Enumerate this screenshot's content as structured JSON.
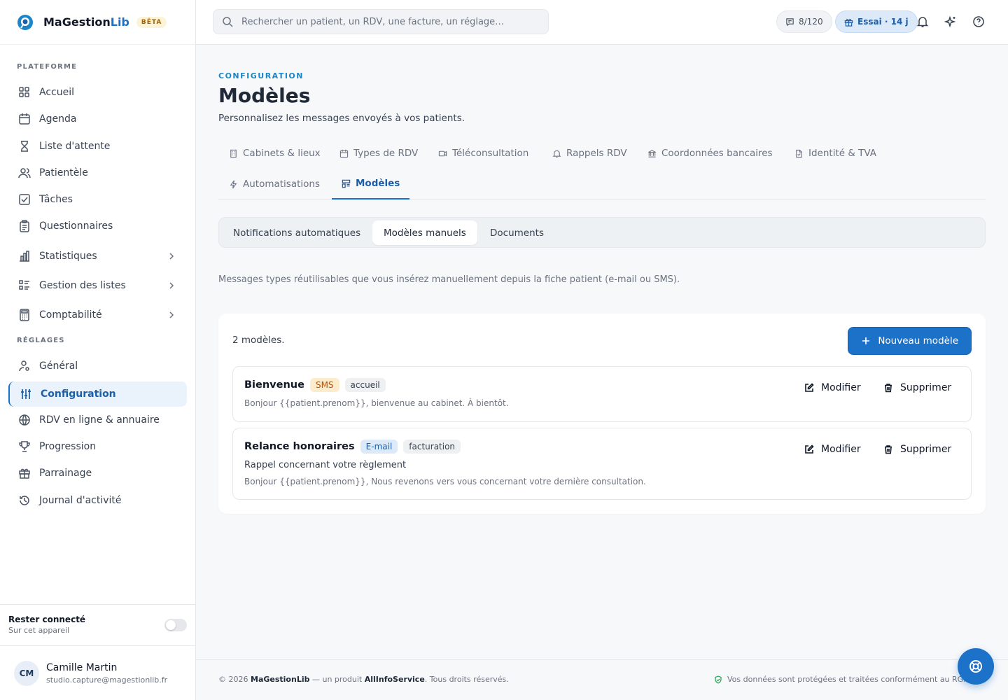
{
  "app": {
    "name_main": "MaGestion",
    "name_accent": "Lib",
    "beta": "BÊTA"
  },
  "sidebar": {
    "section_platform": "PLATEFORME",
    "section_settings": "RÉGLAGES",
    "items": [
      {
        "label": "Accueil",
        "icon": "dashboard-icon"
      },
      {
        "label": "Agenda",
        "icon": "calendar-icon"
      },
      {
        "label": "Liste d'attente",
        "icon": "hourglass-icon"
      },
      {
        "label": "Patientèle",
        "icon": "users-icon"
      },
      {
        "label": "Tâches",
        "icon": "checkbox-icon"
      },
      {
        "label": "Questionnaires",
        "icon": "clipboard-icon"
      },
      {
        "label": "Statistiques",
        "icon": "bar-chart-icon"
      },
      {
        "label": "Gestion des listes",
        "icon": "list-icon"
      },
      {
        "label": "Comptabilité",
        "icon": "calculator-icon"
      },
      {
        "label": "Général",
        "icon": "user-settings-icon"
      },
      {
        "label": "Configuration",
        "icon": "sliders-icon"
      },
      {
        "label": "RDV en ligne & annuaire",
        "icon": "globe-icon"
      },
      {
        "label": "Progression",
        "icon": "trophy-icon"
      },
      {
        "label": "Parrainage",
        "icon": "gift-icon"
      },
      {
        "label": "Journal d'activité",
        "icon": "history-icon"
      }
    ],
    "stay": {
      "title": "Rester connecté",
      "subtitle": "Sur cet appareil"
    },
    "user": {
      "initials": "CM",
      "name": "Camille Martin",
      "email": "studio.capture@magestionlib.fr"
    }
  },
  "topbar": {
    "search_placeholder": "Rechercher un patient, un RDV, une facture, un réglage…",
    "quota": "8/120",
    "trial": "Essai · 14 j"
  },
  "page": {
    "eyebrow": "CONFIGURATION",
    "title": "Modèles",
    "subtitle": "Personnalisez les messages envoyés à vos patients.",
    "tabs": [
      "Cabinets & lieux",
      "Types de RDV",
      "Téléconsultation",
      "Rappels RDV",
      "Coordonnées bancaires",
      "Identité & TVA",
      "Automatisations",
      "Modèles"
    ],
    "segments": [
      "Notifications automatiques",
      "Modèles manuels",
      "Documents"
    ],
    "description": "Messages types réutilisables que vous insérez manuellement depuis la fiche patient (e-mail ou SMS).",
    "count": "2 modèles.",
    "new_button": "Nouveau modèle",
    "templates": [
      {
        "name": "Bienvenue",
        "channel": "SMS",
        "tag": "accueil",
        "subject": "",
        "body": "Bonjour {{patient.prenom}}, bienvenue au cabinet. À bientôt."
      },
      {
        "name": "Relance honoraires",
        "channel": "E-mail",
        "tag": "facturation",
        "subject": "Rappel concernant votre règlement",
        "body": "Bonjour {{patient.prenom}}, Nous revenons vers vous concernant votre dernière consultation."
      }
    ],
    "edit_label": "Modifier",
    "delete_label": "Supprimer"
  },
  "footer": {
    "year": "© 2026",
    "brand": "MaGestionLib",
    "mid": " — un produit ",
    "company": "AllInfoService",
    "rights": ". Tous droits réservés.",
    "privacy": "Vos données sont protégées et traitées conformément au RGPD."
  },
  "colors": {
    "accent": "#1c71c9",
    "eyebrow": "#1c86c9",
    "sms_badge": "#fdeccc",
    "mail_badge": "#dbe9f8"
  }
}
